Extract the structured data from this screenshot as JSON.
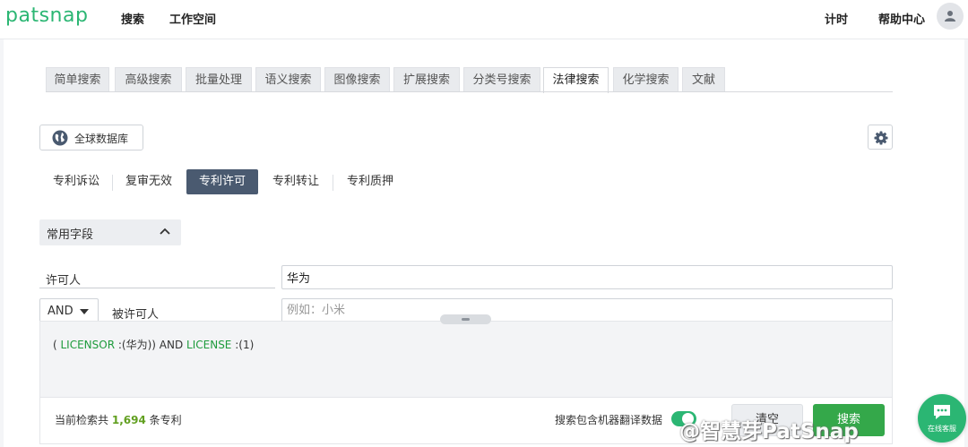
{
  "header": {
    "logo": "patsnap",
    "nav": [
      "搜索",
      "工作空间"
    ],
    "right_nav": [
      "计时",
      "帮助中心"
    ]
  },
  "tabs": [
    {
      "label": "简单搜索",
      "active": false
    },
    {
      "label": "高级搜索",
      "active": false
    },
    {
      "label": "批量处理",
      "active": false
    },
    {
      "label": "语义搜索",
      "active": false
    },
    {
      "label": "图像搜索",
      "active": false
    },
    {
      "label": "扩展搜索",
      "active": false
    },
    {
      "label": "分类号搜索",
      "active": false
    },
    {
      "label": "法律搜索",
      "active": true
    },
    {
      "label": "化学搜索",
      "active": false
    },
    {
      "label": "文献",
      "active": false
    }
  ],
  "database_button": "全球数据库",
  "subtabs": [
    {
      "label": "专利诉讼",
      "active": false
    },
    {
      "label": "复审无效",
      "active": false
    },
    {
      "label": "专利许可",
      "active": true
    },
    {
      "label": "专利转让",
      "active": false
    },
    {
      "label": "专利质押",
      "active": false
    }
  ],
  "field_group": "常用字段",
  "fields": {
    "licensor": {
      "label": "许可人",
      "value": "华为"
    },
    "licensee": {
      "label": "被许可人",
      "placeholder": "例如：小米",
      "operator": "AND"
    }
  },
  "query": {
    "open": "( ",
    "field1": "LICENSOR",
    "part1": " :(华为)) AND  ",
    "field2": "LICENSE",
    "part2": " :(1)"
  },
  "footer": {
    "count_prefix": "当前检索共",
    "count": "1,694",
    "count_suffix": "条专利",
    "machine_translation": "搜索包含机器翻译数据",
    "machine_translation_on": true,
    "clear_button": "清空",
    "search_button": "搜索"
  },
  "watermark": "@智慧芽PatSnap",
  "chat_label": "在线客服",
  "colors": {
    "brand": "#2bb673",
    "active_subtab": "#4a5a70",
    "keyword": "#1e9b3c",
    "count": "#62a021"
  }
}
